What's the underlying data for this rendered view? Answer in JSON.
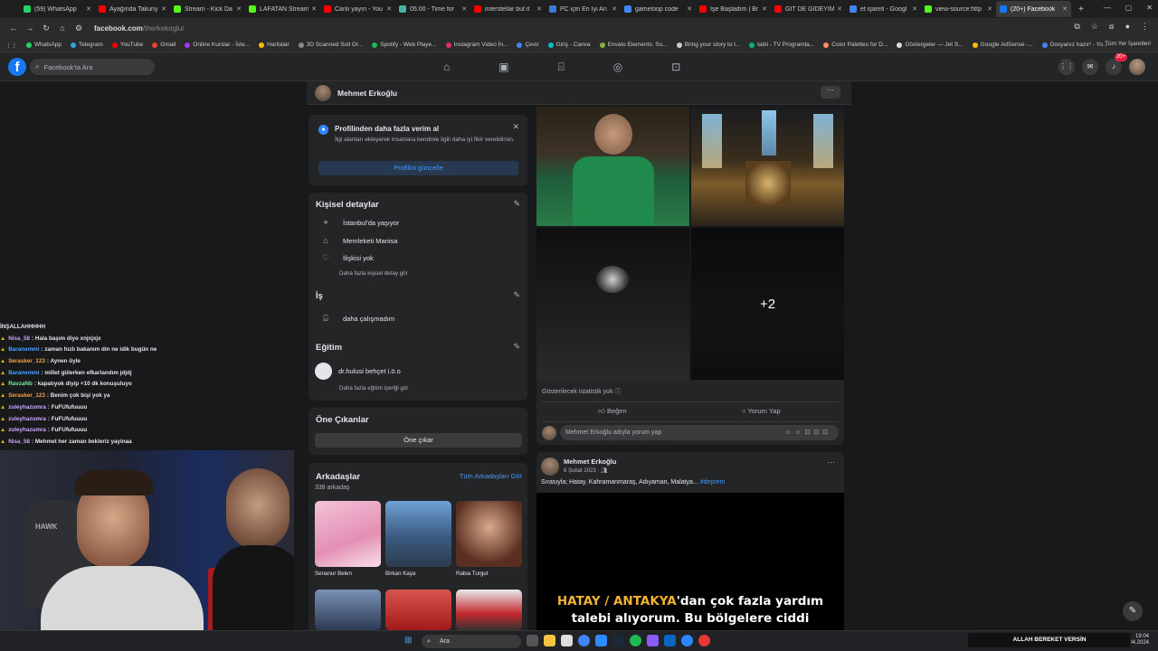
{
  "browser": {
    "tabs": [
      {
        "label": "(59) WhatsApp",
        "color": "#25d366"
      },
      {
        "label": "Ayağında Takunya",
        "color": "#ff0000"
      },
      {
        "label": "Stream - Kick Da",
        "color": "#53fc18"
      },
      {
        "label": "LAFATAN Stream",
        "color": "#53fc18"
      },
      {
        "label": "Canlı yayın - You",
        "color": "#ff0000"
      },
      {
        "label": "05:00 - Time for",
        "color": "#4ab3a0"
      },
      {
        "label": "interstellar but it",
        "color": "#ff0000"
      },
      {
        "label": "PC için En İyi An",
        "color": "#3b7bd6"
      },
      {
        "label": "gameloop code",
        "color": "#4285f4"
      },
      {
        "label": "İşe Başladım | Br",
        "color": "#ff0000"
      },
      {
        "label": "GİT DE GİDEYİM",
        "color": "#ff0000"
      },
      {
        "label": "et işareti - Googl",
        "color": "#4285f4"
      },
      {
        "label": "view-source:http",
        "color": "#53fc18"
      },
      {
        "label": "(20+) Facebook",
        "color": "#1877f2"
      }
    ],
    "url_host": "facebook.com",
    "url_path": "/therkekoglu/",
    "bookmarks": [
      {
        "label": "WhatsApp",
        "color": "#25d366"
      },
      {
        "label": "Telegram",
        "color": "#2aa3e0"
      },
      {
        "label": "YouTube",
        "color": "#ff0000"
      },
      {
        "label": "Gmail",
        "color": "#ea4335"
      },
      {
        "label": "Online Kurslar - İste...",
        "color": "#a435f0"
      },
      {
        "label": "Haritalar",
        "color": "#fbbc04"
      },
      {
        "label": "3D Scanned Soil Gr...",
        "color": "#888888"
      },
      {
        "label": "Spotify - Web Playe...",
        "color": "#1db954"
      },
      {
        "label": "Instagram Video İn...",
        "color": "#e1306c"
      },
      {
        "label": "Çevir",
        "color": "#4285f4"
      },
      {
        "label": "Giriş - Canva",
        "color": "#00c4cc"
      },
      {
        "label": "Envato Elements: Su...",
        "color": "#82b541"
      },
      {
        "label": "Bring your story to l...",
        "color": "#cccccc"
      },
      {
        "label": "tabii - TV Programla...",
        "color": "#00b386"
      },
      {
        "label": "Color Palettes for D...",
        "color": "#ff8a65"
      },
      {
        "label": "Göstergeler — Jet S...",
        "color": "#dddddd"
      },
      {
        "label": "Google AdSense -...",
        "color": "#fbbc04"
      },
      {
        "label": "Dosyanız hazır! - Yo...",
        "color": "#4285f4"
      }
    ],
    "all_bookmarks": "Tüm Yer İşaretleri"
  },
  "facebook": {
    "search_placeholder": "Facebook'ta Ara",
    "notif_badge": "20+",
    "profile_name": "Mehmet Erkoğlu",
    "promo": {
      "title": "Profilinden daha fazla verim al",
      "desc": "İlgi alanları ekleyerek insanlara kendinle ilgili daha iyi fikir verebilirsin.",
      "button": "Profilini güncelle"
    },
    "details": {
      "title": "Kişisel detaylar",
      "items": [
        "İstanbul'da yaşıyor",
        "Memleketi Manisa",
        "İlişkisi yok"
      ],
      "more": "Daha fazla kişisel detay gör"
    },
    "work": {
      "title": "İş",
      "item": "daha çalışmadım"
    },
    "edu": {
      "title": "Eğitim",
      "item": "dr.hulusi behçet i.ö.o",
      "more": "Daha fazla eğitim içeriği gör"
    },
    "featured": {
      "title": "Öne Çıkanlar",
      "button": "Öne çıkar"
    },
    "friends": {
      "title": "Arkadaşlar",
      "see_all": "Tüm Arkadaşları Gör",
      "count": "338 arkadaş",
      "items": [
        "Senanur Belen",
        "Birkan Kaya",
        "Rabia Turgut"
      ]
    },
    "post1": {
      "plus_count": "+2",
      "stats": "Gösterilecek istatistik yok",
      "like": "Beğen",
      "comment": "Yorum Yap",
      "comment_placeholder": "Mehmet Erkoğlu adıyla yorum yap"
    },
    "post2": {
      "author": "Mehmet Erkoğlu",
      "date": "6 Şubat 2023 ·",
      "text": "Sırasıyla; Hatay, Kahramanmaraş, Adıyaman, Malatya...",
      "hashtag": "#deprem",
      "subtitle_highlight": "HATAY / ANTAKYA",
      "subtitle_rest1": "'dan çok fazla yardım",
      "subtitle_rest2": "talebi alıyorum. Bu bölgelere ciddi"
    }
  },
  "stream_chat": {
    "header": "İNŞALLAHHHHH",
    "messages": [
      {
        "user": "Nisa_58",
        "text": ": Hala başım diyo xnjxjxjx",
        "color": "#c9a7ff"
      },
      {
        "user": "Baranemmi",
        "text": ": zaman hızlı bakanım din ne idik bugün ne",
        "color": "#4aa3ff"
      },
      {
        "user": "Serasker_123",
        "text": ": Aynen öyle",
        "color": "#ff9f43"
      },
      {
        "user": "Baranemmi",
        "text": ": millet gülerken efkarlandım jdjdj",
        "color": "#4aa3ff"
      },
      {
        "user": "RavzaNb",
        "text": ": kapatıyok diyip +10 dk konuşuluyo",
        "color": "#7bed9f"
      },
      {
        "user": "Serasker_123",
        "text": ": Benim çok bişi yok ya",
        "color": "#ff9f43"
      },
      {
        "user": "zuleyhazumra",
        "text": ": FuFUfufuuuu",
        "color": "#c9a7ff"
      },
      {
        "user": "zuleyhazumra",
        "text": ": FuFUfufuuuu",
        "color": "#c9a7ff"
      },
      {
        "user": "zuleyhazumra",
        "text": ": FuFUfufuuuu",
        "color": "#c9a7ff"
      },
      {
        "user": "Nisa_58",
        "text": ": Mehmet her zaman bekleriz yayinaa",
        "color": "#c9a7ff"
      }
    ]
  },
  "taskbar": {
    "search": "Ara",
    "ticker": "ALLAH BEREKET VERSİN",
    "time": "19:04",
    "date": "19.04.2024"
  }
}
